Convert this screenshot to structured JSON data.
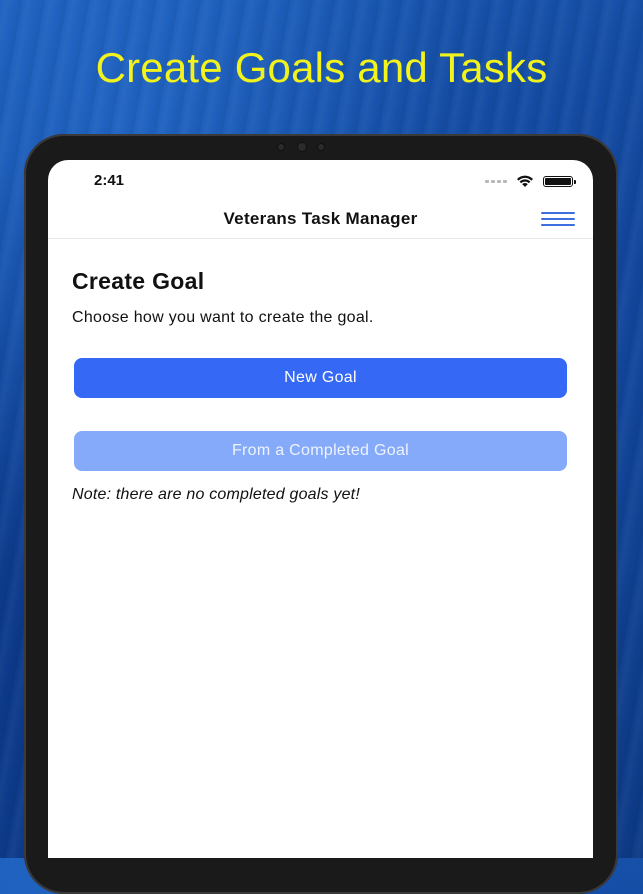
{
  "marketing": {
    "headline": "Create Goals and Tasks"
  },
  "status_bar": {
    "time": "2:41"
  },
  "nav": {
    "title": "Veterans Task Manager",
    "menu_icon": "hamburger-menu-icon"
  },
  "page": {
    "title": "Create Goal",
    "subtitle": "Choose how you want to create the goal."
  },
  "buttons": {
    "new_goal": "New Goal",
    "from_completed": "From a Completed Goal"
  },
  "note": "Note: there are no completed goals yet!",
  "colors": {
    "headline": "#f2f21d",
    "primary_button": "#3468f5",
    "disabled_button": "#84aaf9",
    "menu_icon": "#3d6fe0"
  }
}
